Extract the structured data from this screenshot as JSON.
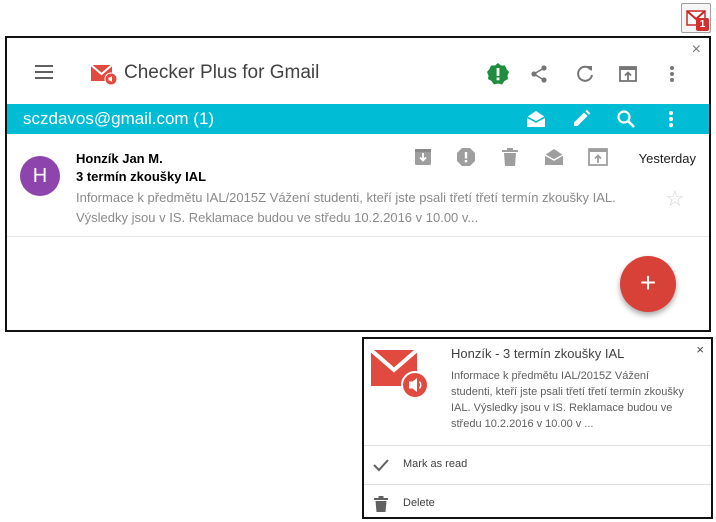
{
  "extension": {
    "badge_count": "1",
    "icon": "gmail-envelope-icon"
  },
  "popup": {
    "app_title": "Checker Plus for Gmail",
    "close_label": "×",
    "header_icons": [
      "menu-icon",
      "important-icon",
      "share-icon",
      "refresh-icon",
      "open-in-tab-icon",
      "more-vert-icon"
    ],
    "account": {
      "email_label": "sczdavos@gmail.com (1)",
      "icons": [
        "mark-read-icon",
        "compose-icon",
        "search-icon",
        "more-vert-icon"
      ]
    },
    "email": {
      "avatar_letter": "H",
      "sender": "Honzík Jan M.",
      "subject": "3 termín zkoušky IAL",
      "snippet": "Informace k předmětu IAL/2015Z Vážení studenti, kteří jste psali třetí třetí termín zkoušky IAL. Výsledky jsou v IS. Reklamace budou ve středu 10.2.2016 v 10.00 v...",
      "date": "Yesterday",
      "star": "☆",
      "actions": [
        "archive-icon",
        "spam-icon",
        "delete-icon",
        "mark-read-icon",
        "open-icon"
      ]
    },
    "fab_label": "+"
  },
  "notification": {
    "title": "Honzík - 3 termín zkoušky IAL",
    "body": "Informace k předmětu IAL/2015Z Vážení studenti, kteří jste psali třetí třetí termín zkoušky IAL. Výsledky jsou v IS. Reklamace budou ve středu 10.2.2016 v 10.00 v ...",
    "close_label": "×",
    "actions": [
      {
        "label": "Mark as read",
        "icon": "check-icon"
      },
      {
        "label": "Delete",
        "icon": "trash-icon"
      }
    ]
  },
  "colors": {
    "accent": "#00bcd4",
    "fab": "#d84137",
    "avatar": "#8e44ad",
    "gmail_red": "#e04a3f",
    "important_green": "#1e8e3e"
  }
}
